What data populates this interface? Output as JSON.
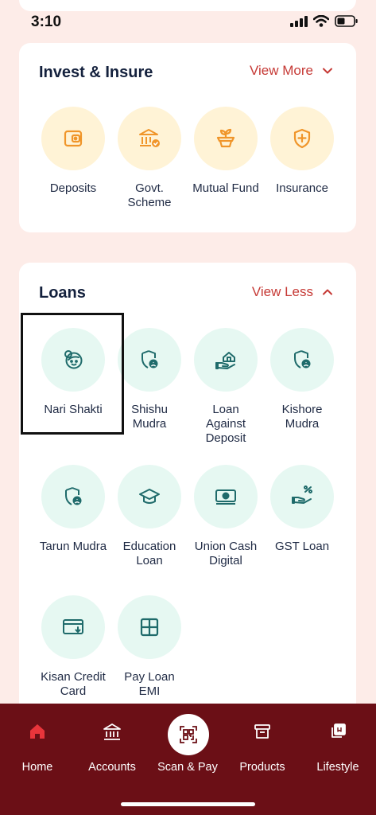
{
  "status_bar": {
    "time": "3:10"
  },
  "invest": {
    "title": "Invest & Insure",
    "toggle_label": "View More",
    "items": [
      {
        "label": "Deposits",
        "icon": "wallet-icon"
      },
      {
        "label": "Govt.\nScheme",
        "icon": "bank-check-icon"
      },
      {
        "label": "Mutual Fund",
        "icon": "plant-pot-icon"
      },
      {
        "label": "Insurance",
        "icon": "shield-plus-icon"
      }
    ]
  },
  "loans": {
    "title": "Loans",
    "toggle_label": "View Less",
    "items": [
      {
        "label": "Nari Shakti",
        "icon": "woman-face-icon"
      },
      {
        "label": "Shishu\nMudra",
        "icon": "shield-user-icon"
      },
      {
        "label": "Loan\nAgainst\nDeposit",
        "icon": "hand-house-icon"
      },
      {
        "label": "Kishore\nMudra",
        "icon": "shield-user-icon"
      },
      {
        "label": "Tarun Mudra",
        "icon": "shield-user-icon"
      },
      {
        "label": "Education\nLoan",
        "icon": "graduation-cap-icon"
      },
      {
        "label": "Union Cash\nDigital",
        "icon": "cash-icon"
      },
      {
        "label": "GST Loan",
        "icon": "hand-percent-icon"
      },
      {
        "label": "Kisan Credit\nCard",
        "icon": "credit-card-icon"
      },
      {
        "label": "Pay Loan\nEMI",
        "icon": "grid-icon"
      }
    ]
  },
  "bottom_nav": {
    "items": [
      {
        "label": "Home",
        "icon": "home-icon",
        "active": true
      },
      {
        "label": "Accounts",
        "icon": "bank-icon"
      },
      {
        "label": "Scan & Pay",
        "icon": "qr-scan-icon"
      },
      {
        "label": "Products",
        "icon": "archive-box-icon"
      },
      {
        "label": "Lifestyle",
        "icon": "layers-icon"
      }
    ]
  },
  "colors": {
    "background": "#fdece8",
    "accent": "#c63a36",
    "nav_bg": "#6b0f16",
    "invest_icon": "#f0952a",
    "loan_icon": "#1f6b6b"
  }
}
